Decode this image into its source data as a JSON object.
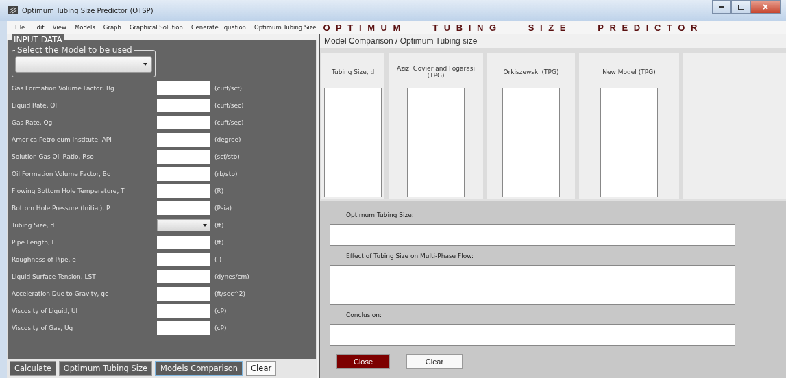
{
  "window": {
    "title": "Optimum Tubing Size Predictor (OTSP)"
  },
  "menu": [
    "File",
    "Edit",
    "View",
    "Models",
    "Graph",
    "Graphical Solution",
    "Generate Equation",
    "Optimum Tubing Size"
  ],
  "app_title": "OPTIMUM TUBING SIZE PREDICTOR",
  "input_data": {
    "legend": "INPUT DATA",
    "model_select": {
      "legend": "Select the Model to be used"
    },
    "fields": [
      {
        "label": "Gas Formation Volume Factor, Bg",
        "kind": "text",
        "unit": "(cuft/scf)"
      },
      {
        "label": "Liquid Rate, Ql",
        "kind": "text",
        "unit": "(cuft/sec)"
      },
      {
        "label": "Gas Rate, Qg",
        "kind": "text",
        "unit": "(cuft/sec)"
      },
      {
        "label": "America Petroleum Institute, API",
        "kind": "text",
        "unit": "(degree)"
      },
      {
        "label": "Solution Gas Oil Ratio, Rso",
        "kind": "text",
        "unit": "(scf/stb)"
      },
      {
        "label": "Oil Formation Volume Factor, Bo",
        "kind": "text",
        "unit": "(rb/stb)"
      },
      {
        "label": "Flowing Bottom Hole Temperature, T",
        "kind": "text",
        "unit": "(R)"
      },
      {
        "label": "Bottom Hole Pressure (Initial), P",
        "kind": "text",
        "unit": "(Psia)"
      },
      {
        "label": "Tubing Size, d",
        "kind": "select",
        "unit": "(ft)"
      },
      {
        "label": "Pipe Length, L",
        "kind": "text",
        "unit": "(ft)"
      },
      {
        "label": "Roughness of Pipe, e",
        "kind": "text",
        "unit": "(-)"
      },
      {
        "label": "Liquid Surface Tension, LST",
        "kind": "text",
        "unit": "(dynes/cm)"
      },
      {
        "label": "Acceleration Due to Gravity, gc",
        "kind": "text",
        "unit": "(ft/sec^2)"
      },
      {
        "label": "Viscosity of Liquid, Ul",
        "kind": "text",
        "unit": "(cP)"
      },
      {
        "label": "Viscosity of Gas, Ug",
        "kind": "text",
        "unit": "(cP)"
      }
    ]
  },
  "buttons": [
    {
      "label": "Calculate",
      "focused": false,
      "kind": "dark"
    },
    {
      "label": "Optimum Tubing Size",
      "kind": "dark",
      "focused": false
    },
    {
      "label": "Models Comparison",
      "kind": "dark",
      "focused": true
    },
    {
      "label": "Clear",
      "kind": "light",
      "focused": false
    }
  ],
  "comparison": {
    "heading": "Model Comparison / Optimum Tubing size",
    "columns": [
      {
        "header": "Tubing Size, d"
      },
      {
        "header": "Aziz, Govier and Fogarasi (TPG)"
      },
      {
        "header": "Orkiszewski (TPG)"
      },
      {
        "header": "New Model (TPG)"
      }
    ]
  },
  "results": [
    {
      "label": "Optimum Tubing Size:",
      "kind": "single"
    },
    {
      "label": "Effect of Tubing Size on Multi-Phase Flow:",
      "kind": "multi"
    },
    {
      "label": "Conclusion:",
      "kind": "single"
    }
  ],
  "actions": [
    {
      "label": "Close",
      "kind": "primary"
    },
    {
      "label": "Clear",
      "kind": "default"
    }
  ]
}
